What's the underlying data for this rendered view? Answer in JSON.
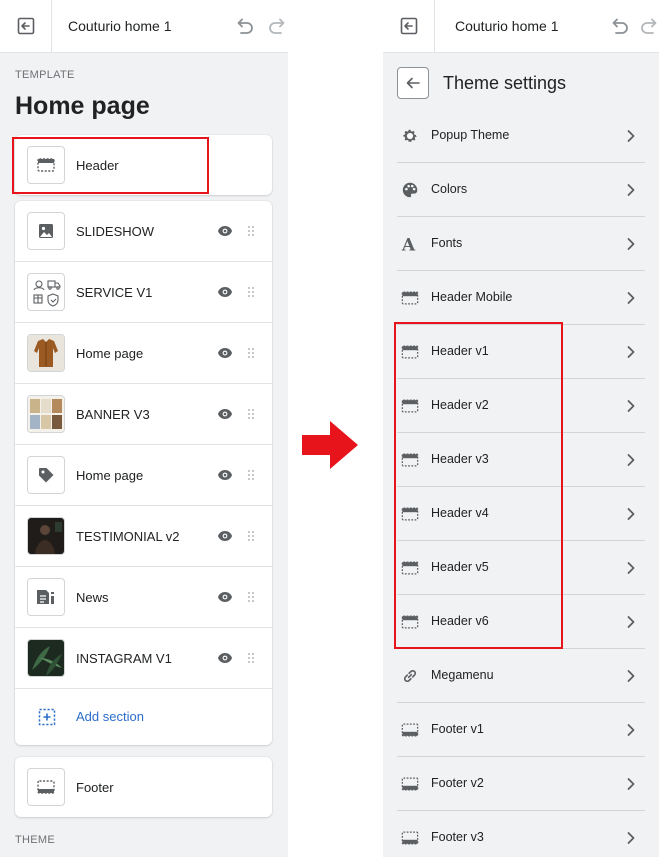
{
  "left": {
    "theme_name": "Couturio home 1",
    "template_label": "TEMPLATE",
    "page_title": "Home page",
    "header_label": "Header",
    "sections": [
      {
        "label": "SLIDESHOW",
        "thumb": "image-icon"
      },
      {
        "label": "SERVICE V1",
        "thumb": "service-thumbnail"
      },
      {
        "label": "Home page",
        "thumb": "jacket-thumbnail"
      },
      {
        "label": "BANNER V3",
        "thumb": "banner-thumbnail"
      },
      {
        "label": "Home page",
        "thumb": "tag-icon"
      },
      {
        "label": "TESTIMONIAL v2",
        "thumb": "testimonial-thumbnail"
      },
      {
        "label": "News",
        "thumb": "blog-icon"
      },
      {
        "label": "INSTAGRAM V1",
        "thumb": "instagram-thumbnail"
      }
    ],
    "add_section_label": "Add section",
    "footer_label": "Footer",
    "theme_label": "THEME"
  },
  "right": {
    "theme_name": "Couturio home 1",
    "settings_title": "Theme settings",
    "items": [
      {
        "label": "Popup Theme",
        "icon": "gear-icon"
      },
      {
        "label": "Colors",
        "icon": "palette-icon"
      },
      {
        "label": "Fonts",
        "icon": "font-icon"
      },
      {
        "label": "Header Mobile",
        "icon": "header-layout-icon"
      },
      {
        "label": "Header v1",
        "icon": "header-layout-icon"
      },
      {
        "label": "Header v2",
        "icon": "header-layout-icon"
      },
      {
        "label": "Header v3",
        "icon": "header-layout-icon"
      },
      {
        "label": "Header v4",
        "icon": "header-layout-icon"
      },
      {
        "label": "Header v5",
        "icon": "header-layout-icon"
      },
      {
        "label": "Header v6",
        "icon": "header-layout-icon"
      },
      {
        "label": "Megamenu",
        "icon": "link-icon"
      },
      {
        "label": "Footer v1",
        "icon": "footer-layout-icon"
      },
      {
        "label": "Footer v2",
        "icon": "footer-layout-icon"
      },
      {
        "label": "Footer v3",
        "icon": "footer-layout-icon"
      }
    ]
  },
  "colors": {
    "highlight": "#e8141c",
    "accent_link": "#2c6ecb",
    "panel_bg": "#f1f2f3"
  }
}
